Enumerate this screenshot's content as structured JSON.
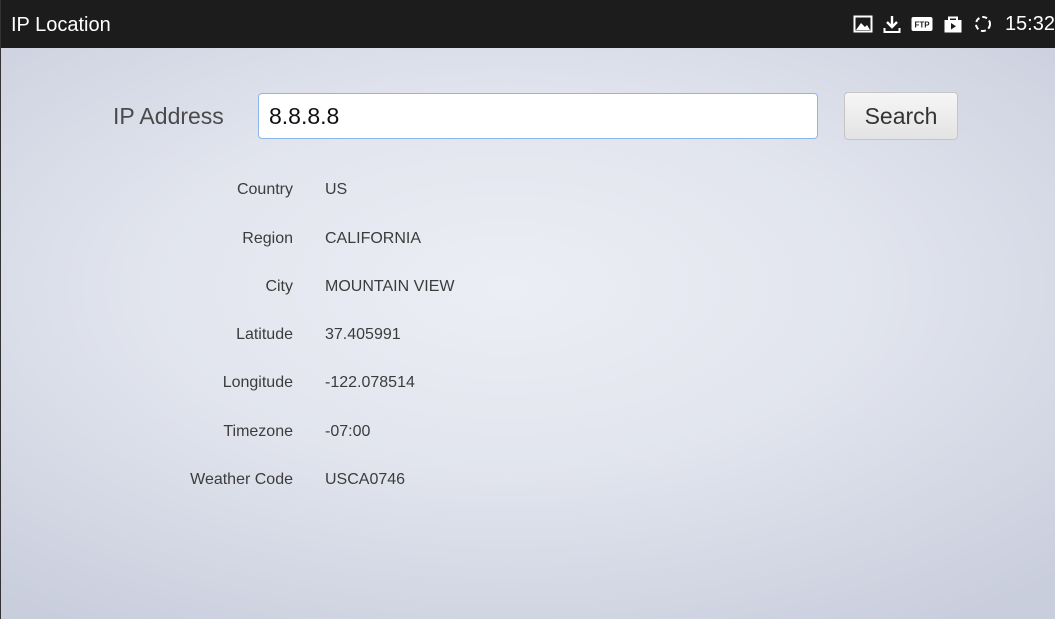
{
  "statusbar": {
    "app_title": "IP Location",
    "icons": [
      "image-icon",
      "download-icon",
      "ftp-icon",
      "bag-icon",
      "sync-icon"
    ],
    "ftp_text": "FTP",
    "clock": "15:32"
  },
  "form": {
    "ip_label": "IP Address",
    "ip_value": "8.8.8.8",
    "search_label": "Search"
  },
  "fields": [
    {
      "label": "Country",
      "value": "US"
    },
    {
      "label": "Region",
      "value": "CALIFORNIA"
    },
    {
      "label": "City",
      "value": "MOUNTAIN VIEW"
    },
    {
      "label": "Latitude",
      "value": "37.405991"
    },
    {
      "label": "Longitude",
      "value": "-122.078514"
    },
    {
      "label": "Timezone",
      "value": "-07:00"
    },
    {
      "label": "Weather Code",
      "value": "USCA0746"
    }
  ],
  "colors": {
    "statusbar_bg": "#1c1c1c",
    "input_border": "#8db6e8",
    "text": "#3c3c3c"
  }
}
